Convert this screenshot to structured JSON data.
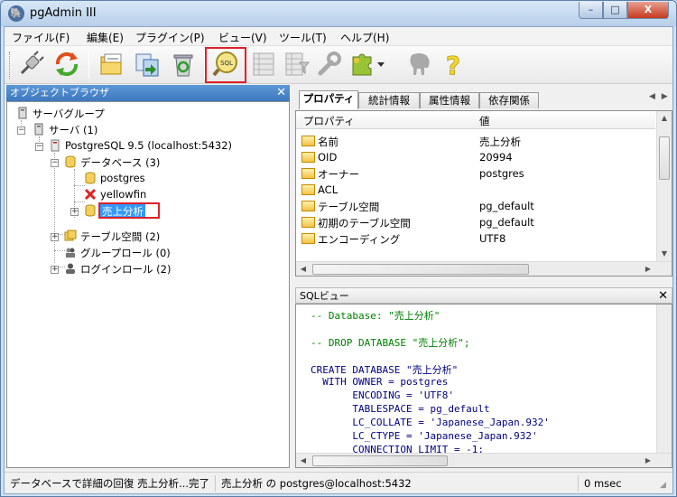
{
  "window": {
    "title": "pgAdmin III",
    "minimize": "–",
    "maximize": "□",
    "close": "X"
  },
  "menu": [
    "ファイル(F)",
    "編集(E)",
    "プラグイン(P)",
    "ビュー(V)",
    "ツール(T)",
    "ヘルプ(H)"
  ],
  "toolbar": {
    "sql_label": "SQL",
    "help_label": "?"
  },
  "browser": {
    "title": "オブジェクトブラウザ",
    "close": "✕",
    "tree": {
      "server_groups": "サーバグループ",
      "servers": "サーバ (1)",
      "server": "PostgreSQL 9.5 (localhost:5432)",
      "databases": "データベース (3)",
      "db_postgres": "postgres",
      "db_yellowfin": "yellowfin",
      "db_sales": "売上分析",
      "tablespaces": "テーブル空間 (2)",
      "group_roles": "グループロール (0)",
      "login_roles": "ログインロール (2)"
    }
  },
  "tabs": [
    "プロパティ",
    "統計情報",
    "属性情報",
    "依存関係"
  ],
  "properties": {
    "col_property": "プロパティ",
    "col_value": "値",
    "rows": [
      {
        "name": "名前",
        "value": "売上分析"
      },
      {
        "name": "OID",
        "value": "20994"
      },
      {
        "name": "オーナー",
        "value": "postgres"
      },
      {
        "name": "ACL",
        "value": ""
      },
      {
        "name": "テーブル空間",
        "value": "pg_default"
      },
      {
        "name": "初期のテーブル空間",
        "value": "pg_default"
      },
      {
        "name": "エンコーディング",
        "value": "UTF8"
      }
    ]
  },
  "sql_pane": {
    "title": "SQLビュー",
    "close": "✕",
    "lines": [
      "-- Database: \"売上分析\"",
      "",
      "-- DROP DATABASE \"売上分析\";",
      "",
      "CREATE DATABASE \"売上分析\"",
      "  WITH OWNER = postgres",
      "       ENCODING = 'UTF8'",
      "       TABLESPACE = pg_default",
      "       LC_COLLATE = 'Japanese_Japan.932'",
      "       LC_CTYPE = 'Japanese_Japan.932'",
      "       CONNECTION LIMIT = -1;"
    ]
  },
  "status": {
    "message": "データベースで詳細の回復 売上分析...完了",
    "connection": "売上分析 の postgres@localhost:5432",
    "timing": "0 msec"
  },
  "colors": {
    "selection": "#3399ff",
    "highlight_box": "#e0202a",
    "sql_comment": "#008000",
    "sql_keyword": "#000080",
    "sql_string": "#7f007f"
  }
}
